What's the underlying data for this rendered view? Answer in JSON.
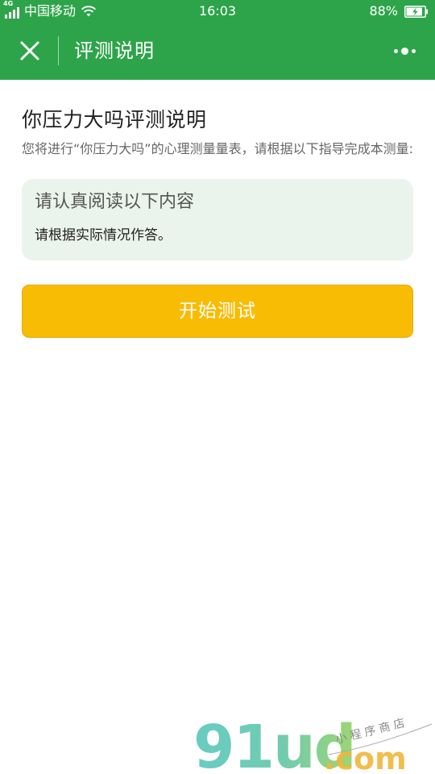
{
  "status_bar": {
    "network_tag": "4G",
    "carrier": "中国移动",
    "time": "16:03",
    "battery": "88%",
    "battery_level": 0.88
  },
  "title_bar": {
    "title": "评测说明"
  },
  "content": {
    "heading": "你压力大吗评测说明",
    "description": "您将进行“你压力大吗”的心理测量量表，请根据以下指导完成本测量:",
    "notice": {
      "title": "请认真阅读以下内容",
      "text": "请根据实际情况作答。"
    },
    "start_button": "开始测试"
  },
  "watermark": {
    "brand": "91ud",
    "suffix": ".com",
    "tagline": "小 程 序 商 店"
  },
  "colors": {
    "header_green": "#2ea44a",
    "button_yellow": "#f9bc05",
    "card_bg": "#ebf4ec"
  }
}
